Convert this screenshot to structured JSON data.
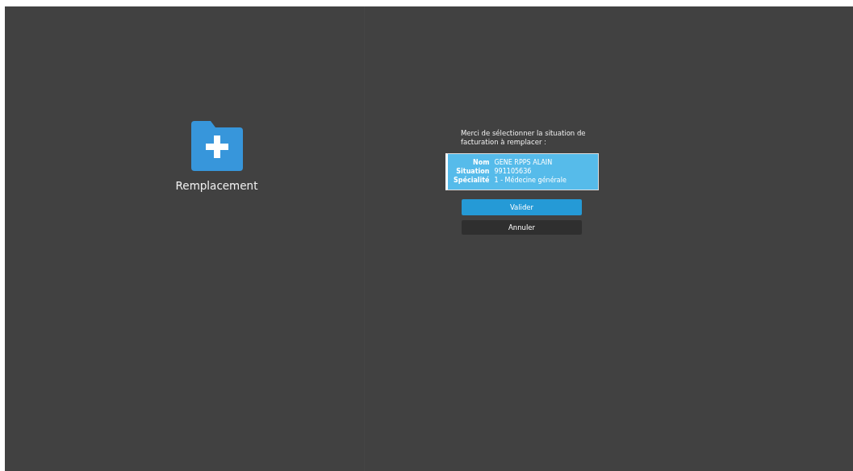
{
  "shortcut": {
    "label": "Remplacement"
  },
  "prompt": "Merci de sélectionner la situation de facturation à remplacer :",
  "situations": [
    {
      "selected": true,
      "fields": [
        {
          "label": "Nom",
          "value": "GENE RPPS ALAIN"
        },
        {
          "label": "Situation",
          "value": "991105636"
        },
        {
          "label": "Spécialité",
          "value": "1 - Médecine générale"
        }
      ]
    }
  ],
  "buttons": [
    {
      "label": "Valider",
      "kind": "primary"
    },
    {
      "label": "Annuler",
      "kind": "secondary"
    }
  ]
}
